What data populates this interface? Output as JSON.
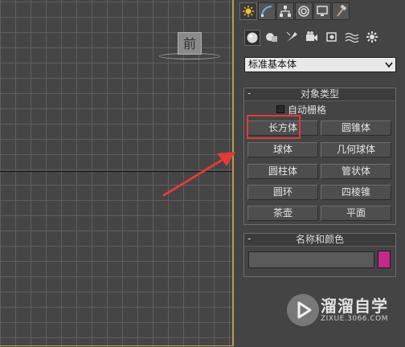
{
  "viewport": {
    "viewcube_label": "前",
    "border_color": "#b7a04e"
  },
  "command_panel": {
    "top_tabs": [
      {
        "icon": "create-sun-icon",
        "active": true
      },
      {
        "icon": "modify-curve-icon",
        "active": false
      },
      {
        "icon": "hierarchy-icon",
        "active": false
      },
      {
        "icon": "motion-icon",
        "active": false
      },
      {
        "icon": "display-monitor-icon",
        "active": false
      },
      {
        "icon": "utilities-hammer-icon",
        "active": false
      }
    ],
    "category_tabs": [
      {
        "icon": "geometry-sphere-icon",
        "active": true
      },
      {
        "icon": "shapes-icon",
        "active": false
      },
      {
        "icon": "lights-icon",
        "active": false
      },
      {
        "icon": "cameras-icon",
        "active": false
      },
      {
        "icon": "helpers-icon",
        "active": false
      },
      {
        "icon": "spacewarps-icon",
        "active": false
      },
      {
        "icon": "systems-icon",
        "active": false
      }
    ],
    "dropdown_value": "标准基本体",
    "object_type": {
      "title": "对象类型",
      "collapse": "-",
      "autogrid_label": "自动栅格",
      "buttons": [
        "长方体",
        "圆锥体",
        "球体",
        "几何球体",
        "圆柱体",
        "管状体",
        "圆环",
        "四棱锥",
        "茶壶",
        "平面"
      ],
      "highlight_color": "#e23a3a"
    },
    "name_color": {
      "title": "名称和颜色",
      "collapse": "-",
      "name_value": "",
      "swatch_color": "#c42a8b"
    }
  },
  "watermark": {
    "title": "溜溜自学",
    "url": "ZIXUE.3066.COM"
  }
}
